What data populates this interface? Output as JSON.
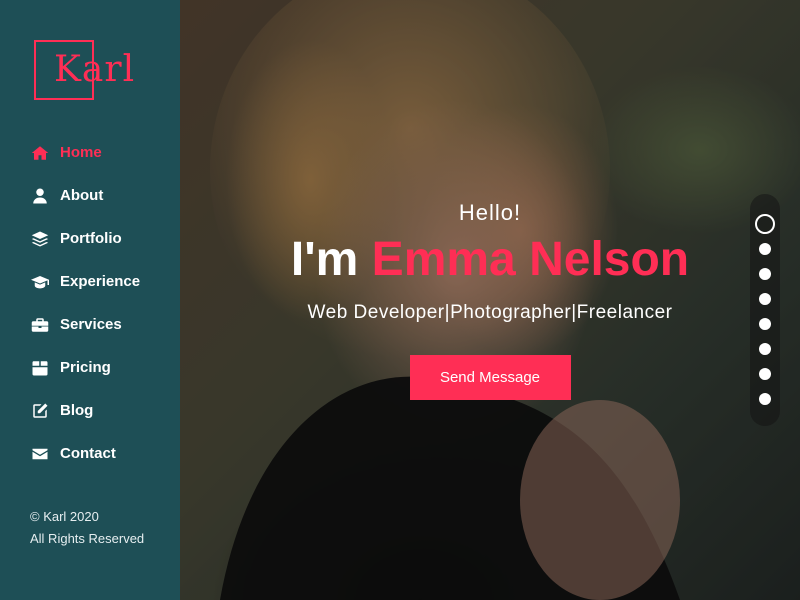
{
  "logo": {
    "text": "Karl",
    "brand_color": "#ff2e55"
  },
  "sidebar": {
    "background": "#1e4f56",
    "items": [
      {
        "label": "Home",
        "icon": "home-icon",
        "active": true
      },
      {
        "label": "About",
        "icon": "user-icon",
        "active": false
      },
      {
        "label": "Portfolio",
        "icon": "layers-icon",
        "active": false
      },
      {
        "label": "Experience",
        "icon": "graduation-cap-icon",
        "active": false
      },
      {
        "label": "Services",
        "icon": "briefcase-icon",
        "active": false
      },
      {
        "label": "Pricing",
        "icon": "box-icon",
        "active": false
      },
      {
        "label": "Blog",
        "icon": "edit-icon",
        "active": false
      },
      {
        "label": "Contact",
        "icon": "envelope-icon",
        "active": false
      }
    ],
    "footer": {
      "copyright": "© Karl 2020",
      "rights": "All Rights Reserved"
    }
  },
  "hero": {
    "greeting": "Hello!",
    "intro": "I'm",
    "name": "Emma Nelson",
    "roles": "Web Developer|Photographer|Freelancer",
    "cta_label": "Send Message",
    "accent_color": "#ff2e55"
  },
  "slider_dots": {
    "count": 8,
    "active_index": 0
  }
}
